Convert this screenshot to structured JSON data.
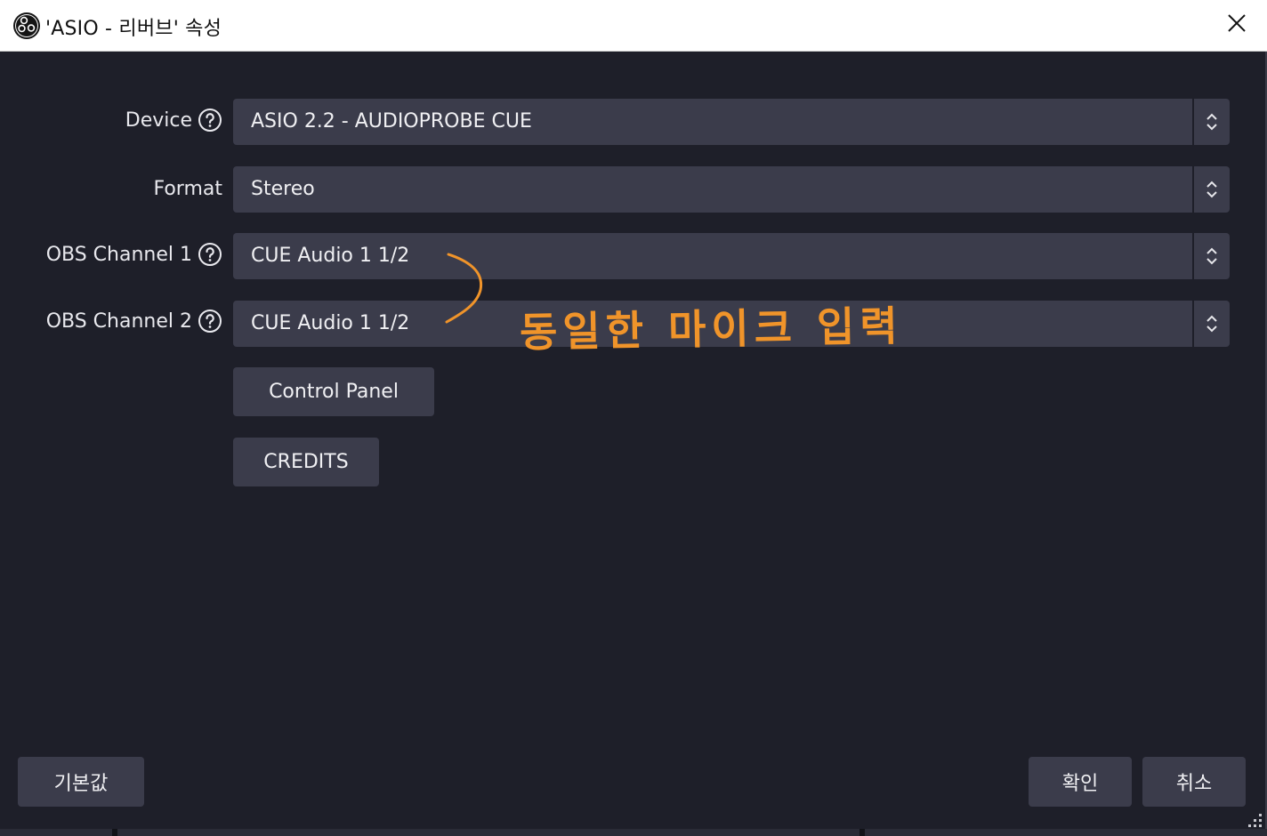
{
  "window": {
    "title": "'ASIO - 리버브' 속성"
  },
  "form": {
    "device": {
      "label": "Device",
      "value": "ASIO 2.2 - AUDIOPROBE CUE"
    },
    "format": {
      "label": "Format",
      "value": "Stereo"
    },
    "channel1": {
      "label": "OBS Channel 1",
      "value": "CUE Audio 1 1/2"
    },
    "channel2": {
      "label": "OBS Channel 2",
      "value": "CUE Audio 1 1/2"
    },
    "control_panel_label": "Control Panel",
    "credits_label": "CREDITS"
  },
  "annotation": {
    "text": "동일한 마이크 입력",
    "color": "#f0942a"
  },
  "footer": {
    "defaults_label": "기본값",
    "ok_label": "확인",
    "cancel_label": "취소"
  },
  "icons": {
    "app": "obs-logo-icon",
    "close": "close-icon",
    "help": "help-icon",
    "select_arrows": "updown-arrows-icon",
    "resize": "resize-grip-icon"
  },
  "colors": {
    "background": "#1e1f29",
    "control": "#3b3c4b",
    "text": "#f0f0f3",
    "annotation": "#f0942a"
  }
}
